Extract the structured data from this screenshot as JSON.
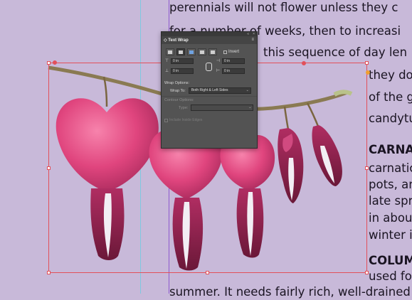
{
  "body_lines": [
    "perennials will not flower unless they c",
    "for a number of weeks, then to increasi",
    "this sequence of day len",
    "they do",
    "of the g",
    "candytu",
    "CARNA",
    "carnatic",
    "pots, an",
    "late spri",
    "in abou",
    "winter i",
    "COLUM",
    "used fo",
    "summer. It needs fairly rich, well-drained"
  ],
  "panel": {
    "title": "Text Wrap",
    "invert_label": "Invert",
    "offsets": {
      "top": "0 in",
      "bottom": "0 in",
      "left": "0 in",
      "right": "0 in"
    },
    "wrap_options_label": "Wrap Options:",
    "wrap_to_label": "Wrap To:",
    "wrap_to_value": "Both Right & Left Sides",
    "contour_options_label": "Contour Options:",
    "type_label": "Type:",
    "type_value": "",
    "include_inside_edges": "Include Inside Edges"
  },
  "colors": {
    "background": "#c8b9d9",
    "frame": "#e2505a",
    "guide_cyan": "#7ec8e0",
    "guide_purple": "#8e5ad0",
    "panel": "#535353",
    "flower_pink": "#e0457e",
    "flower_dark": "#8e1f4e",
    "stem": "#8a7a52"
  },
  "icons": [
    "chain-link-icon",
    "menu-icon",
    "collapse-icon",
    "close-icon"
  ]
}
